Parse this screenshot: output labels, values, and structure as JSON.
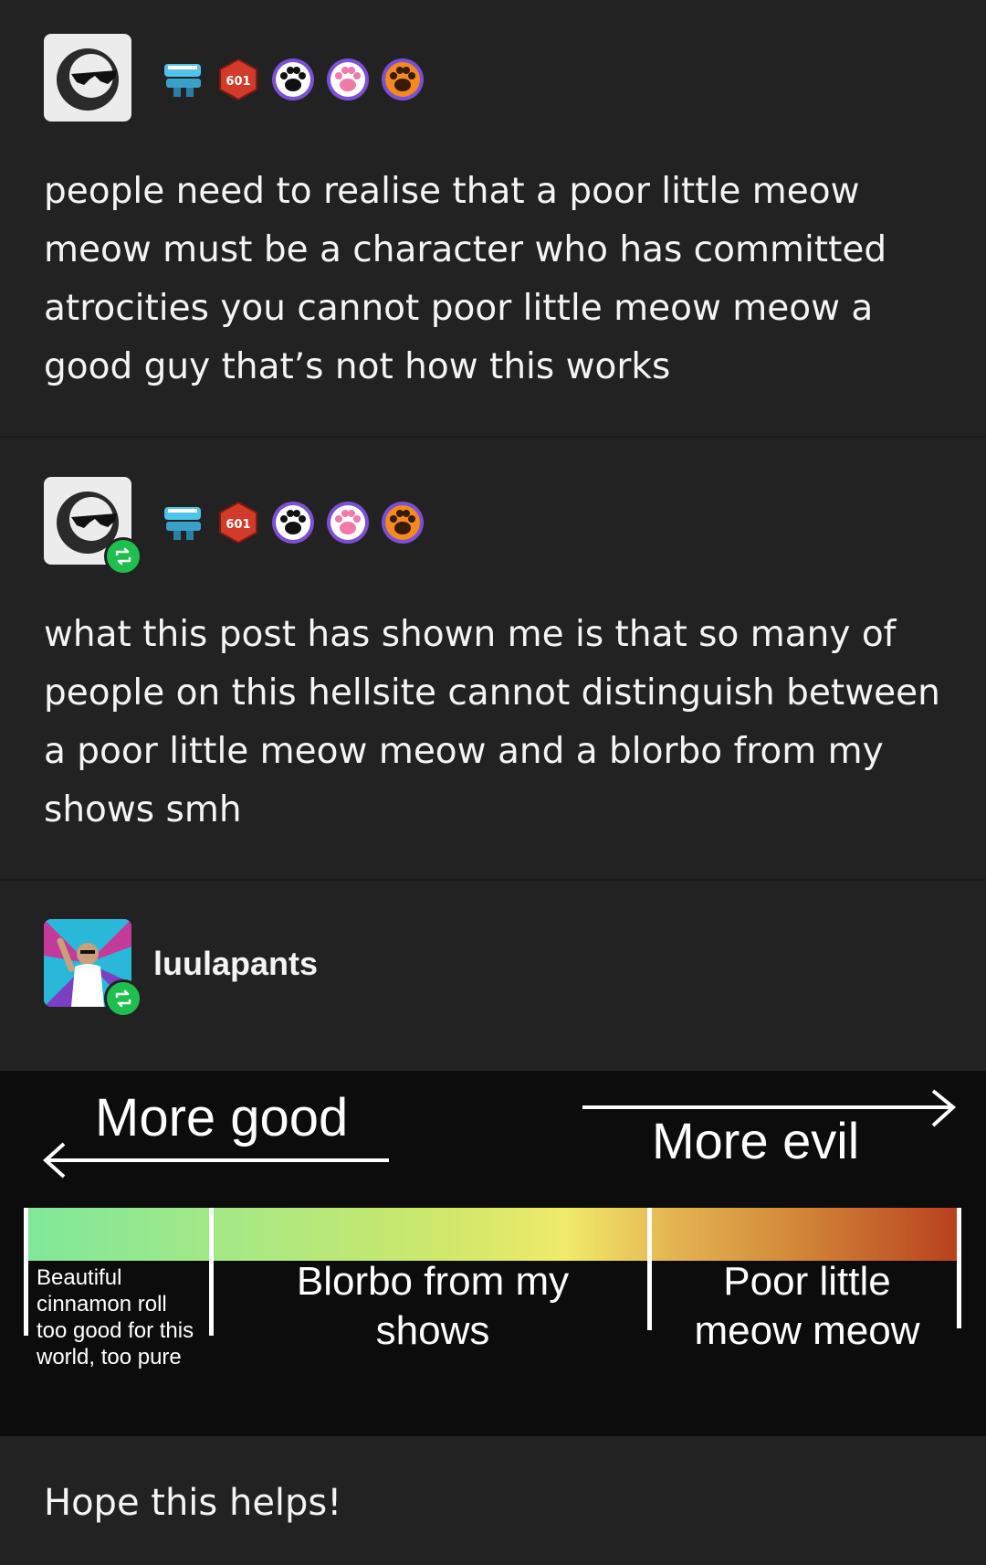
{
  "posts": [
    {
      "text_lines": [
        "people need to realise that a poor little meow",
        "meow must be a character who has committed",
        "atrocities you cannot poor little meow meow a",
        "good guy that’s not how this works"
      ]
    },
    {
      "text_lines": [
        "what this post has shown me is that so many of",
        "people on this hellsite cannot distinguish between",
        "a poor little meow meow and a blorbo from my",
        "shows smh"
      ]
    }
  ],
  "badges": {
    "d20_number": "601"
  },
  "reblogger": {
    "username": "luulapants"
  },
  "meme": {
    "more_good": "More good",
    "more_evil": "More evil",
    "left_label": [
      "Beautiful",
      "cinnamon roll",
      "too good for this",
      "world, too pure"
    ],
    "middle_label": [
      "Blorbo from my",
      "shows"
    ],
    "right_label": [
      "Poor little",
      "meow meow"
    ]
  },
  "footer": {
    "text": "Hope this helps!"
  }
}
